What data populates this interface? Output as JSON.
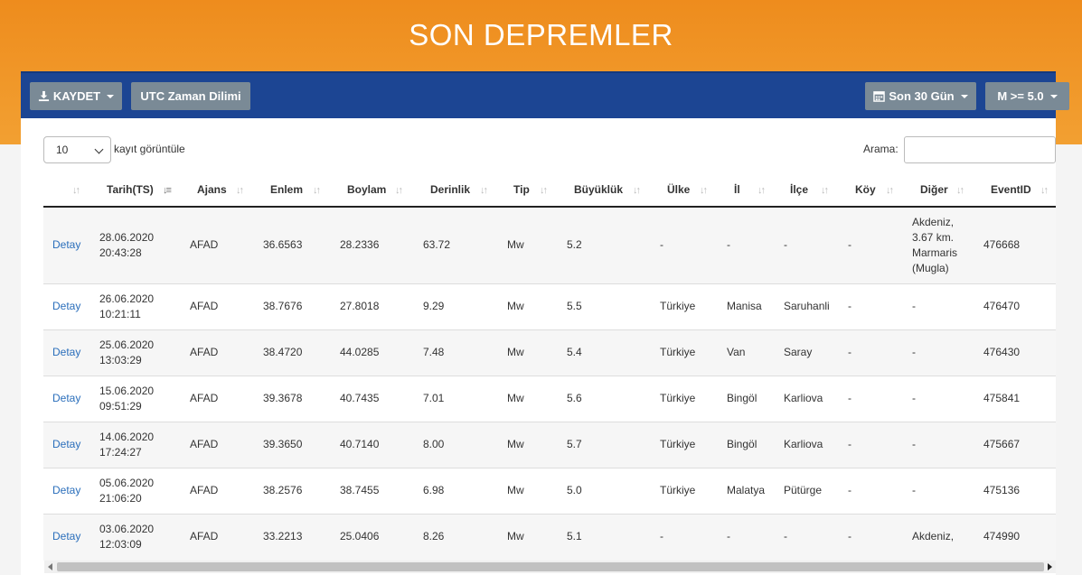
{
  "page": {
    "title": "SON DEPREMLER"
  },
  "toolbar": {
    "save_label": "KAYDET",
    "utc_label": "UTC Zaman Dilimi",
    "period_label": "Son 30 Gün",
    "magnitude_label": "M >= 5.0"
  },
  "controls": {
    "length_value": "10",
    "length_label": "kayıt görüntüle",
    "search_label": "Arama:",
    "search_value": ""
  },
  "table": {
    "headers": [
      "",
      "Tarih(TS)",
      "Ajans",
      "Enlem",
      "Boylam",
      "Derinlik",
      "Tip",
      "Büyüklük",
      "Ülke",
      "İl",
      "İlçe",
      "Köy",
      "Diğer",
      "EventID"
    ],
    "rows": [
      {
        "detail": "Detay",
        "date": "28.06.2020",
        "time": "20:43:28",
        "agency": "AFAD",
        "lat": "36.6563",
        "lon": "28.2336",
        "depth": "63.72",
        "type": "Mw",
        "mag": "5.2",
        "country": "-",
        "province": "-",
        "district": "-",
        "village": "-",
        "other": "Akdeniz, 3.67 km. Marmaris (Mugla)",
        "event_id": "476668"
      },
      {
        "detail": "Detay",
        "date": "26.06.2020",
        "time": "10:21:11",
        "agency": "AFAD",
        "lat": "38.7676",
        "lon": "27.8018",
        "depth": "9.29",
        "type": "Mw",
        "mag": "5.5",
        "country": "Türkiye",
        "province": "Manisa",
        "district": "Saruhanli",
        "village": "-",
        "other": "-",
        "event_id": "476470"
      },
      {
        "detail": "Detay",
        "date": "25.06.2020",
        "time": "13:03:29",
        "agency": "AFAD",
        "lat": "38.4720",
        "lon": "44.0285",
        "depth": "7.48",
        "type": "Mw",
        "mag": "5.4",
        "country": "Türkiye",
        "province": "Van",
        "district": "Saray",
        "village": "-",
        "other": "-",
        "event_id": "476430"
      },
      {
        "detail": "Detay",
        "date": "15.06.2020",
        "time": "09:51:29",
        "agency": "AFAD",
        "lat": "39.3678",
        "lon": "40.7435",
        "depth": "7.01",
        "type": "Mw",
        "mag": "5.6",
        "country": "Türkiye",
        "province": "Bingöl",
        "district": "Karliova",
        "village": "-",
        "other": "-",
        "event_id": "475841"
      },
      {
        "detail": "Detay",
        "date": "14.06.2020",
        "time": "17:24:27",
        "agency": "AFAD",
        "lat": "39.3650",
        "lon": "40.7140",
        "depth": "8.00",
        "type": "Mw",
        "mag": "5.7",
        "country": "Türkiye",
        "province": "Bingöl",
        "district": "Karliova",
        "village": "-",
        "other": "-",
        "event_id": "475667"
      },
      {
        "detail": "Detay",
        "date": "05.06.2020",
        "time": "21:06:20",
        "agency": "AFAD",
        "lat": "38.2576",
        "lon": "38.7455",
        "depth": "6.98",
        "type": "Mw",
        "mag": "5.0",
        "country": "Türkiye",
        "province": "Malatya",
        "district": "Pütürge",
        "village": "-",
        "other": "-",
        "event_id": "475136"
      },
      {
        "detail": "Detay",
        "date": "03.06.2020",
        "time": "12:03:09",
        "agency": "AFAD",
        "lat": "33.2213",
        "lon": "25.0406",
        "depth": "8.26",
        "type": "Mw",
        "mag": "5.1",
        "country": "-",
        "province": "-",
        "district": "-",
        "village": "-",
        "other": "Akdeniz,",
        "event_id": "474990"
      }
    ]
  },
  "icons": {
    "save": "download-icon",
    "period": "calendar-icon"
  },
  "colors": {
    "header": "#f2a032",
    "toolbar": "#1c4593",
    "button": "#7a8a96",
    "link": "#2a6ebb"
  }
}
